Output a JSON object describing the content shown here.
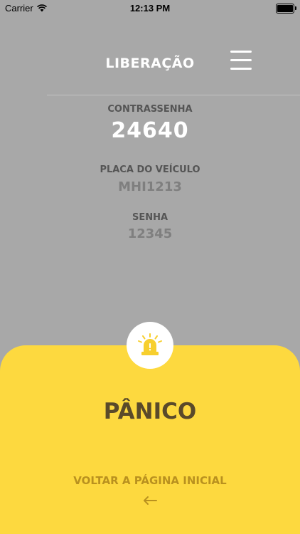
{
  "status_bar": {
    "carrier": "Carrier",
    "time": "12:13 PM",
    "wifi_icon": "wifi-icon",
    "battery_icon": "battery-icon"
  },
  "header": {
    "title": "LIBERAÇÃO",
    "menu_icon": "hamburger-menu-icon"
  },
  "fields": {
    "contrassenha": {
      "label": "CONTRASSENHA",
      "value": "24640"
    },
    "placa": {
      "label": "PLACA DO VEÍCULO",
      "value": "MHI1213"
    },
    "senha": {
      "label": "SENHA",
      "value": "12345"
    }
  },
  "panel": {
    "alarm_icon": "siren-alarm-icon",
    "panic_label": "PÂNICO",
    "back_label": "VOLTAR A PÁGINA INICIAL",
    "back_arrow_icon": "arrow-left-icon"
  },
  "colors": {
    "background": "#a8a8a8",
    "panel": "#fdd93f",
    "panic_text": "#5a4a2a",
    "back_text": "#b9911f",
    "alarm_accent": "#f7cf2e"
  }
}
